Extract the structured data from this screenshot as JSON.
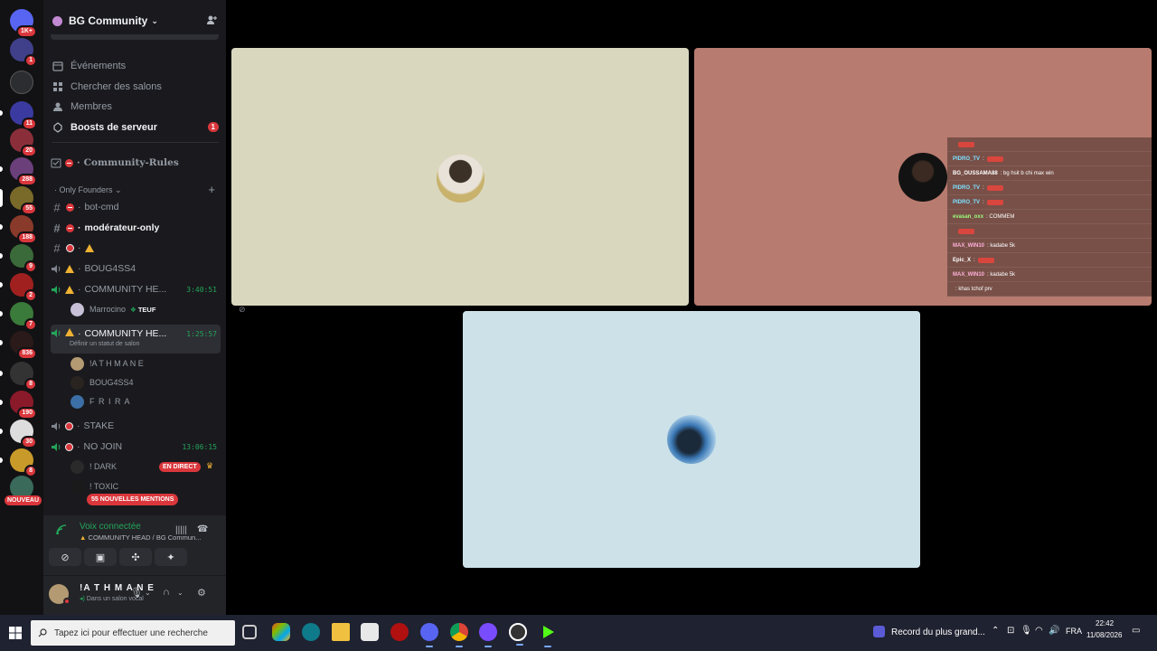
{
  "server_rail": {
    "badges": [
      "1K+",
      "1",
      "11",
      "20",
      "288",
      "55",
      "188",
      "9",
      "2",
      "7",
      "836",
      "8",
      "190",
      "30",
      "8"
    ],
    "new_label": "NOUVEAU"
  },
  "guild": {
    "name": "BG Community"
  },
  "shortcuts": [
    {
      "label": "Événements",
      "icon": "calendar-icon"
    },
    {
      "label": "Chercher des salons",
      "icon": "channel-browse-icon"
    },
    {
      "label": "Membres",
      "icon": "members-icon"
    },
    {
      "label": "Boosts de serveur",
      "icon": "boost-icon",
      "badge": "1"
    }
  ],
  "rules_channel": "Community-Rules",
  "category": "Only Founders",
  "channels": {
    "bot_cmd": "bot-cmd",
    "moderateur": "modérateur-only",
    "boug": "BOUG4SS4",
    "community1": "COMMUNITY HE...",
    "community1_timer": "3:40:51",
    "marrocino": "Marrocino",
    "teuf_tag": "TEUF",
    "community2": "COMMUNITY HE...",
    "community2_timer": "1:25:57",
    "community2_status": "Définir un statut de salon",
    "member1": "!A T H M A N E",
    "member2": "BOUG4SS4",
    "member3": "F R I R A",
    "stake": "STAKE",
    "nojoin": "NO JOIN",
    "nojoin_timer": "13:06:15",
    "dark": "! DARK",
    "live": "EN DIRECT",
    "toxic": "! TOXIC",
    "mentions": "55 NOUVELLES MENTIONS"
  },
  "voice": {
    "title": "Voix connectée",
    "subtitle": "COMMUNITY HEAD / BG Commun..."
  },
  "user": {
    "name": "!A T H M A N E",
    "status": "Dans un salon vocal"
  },
  "chat_overlay": [
    {
      "name": "",
      "text": "",
      "name_color": "#ff6b7d",
      "emote": true
    },
    {
      "name": "PIDRO_TV",
      "text": ":",
      "name_color": "#7ee0ff",
      "emote": true
    },
    {
      "name": "BG_OUSSAMA88",
      "text": ": bg hsit b chi max win",
      "name_color": "#ffffff",
      "emote": false
    },
    {
      "name": "PIDRO_TV",
      "text": ":",
      "name_color": "#7ee0ff",
      "emote": true
    },
    {
      "name": "PIDRO_TV",
      "text": ":",
      "name_color": "#7ee0ff",
      "emote": true
    },
    {
      "name": "evasan_oxx",
      "text": ": COMMEM",
      "name_color": "#9cff7a",
      "emote": false
    },
    {
      "name": "",
      "text": "",
      "name_color": "#ff6b7d",
      "emote": true
    },
    {
      "name": "MAX_WIN10",
      "text": ": kadabe 5k",
      "name_color": "#ffb0d9",
      "emote": false
    },
    {
      "name": "Epic_X",
      "text": ":",
      "name_color": "#ffffff",
      "emote": true
    },
    {
      "name": "MAX_WIN10",
      "text": ": kadabe 5k",
      "name_color": "#ffb0d9",
      "emote": false
    },
    {
      "name": "",
      "text": ": khas tchof prv",
      "name_color": "#ff6b7d",
      "emote": false
    }
  ],
  "taskbar": {
    "search_placeholder": "Tapez ici pour effectuer une recherche",
    "notification": "Record du plus grand...",
    "lang": "FRA",
    "time": "22:42",
    "date": "11/08/2026"
  },
  "colors": {
    "tile1": "#dad7bf",
    "tile2": "#b87b6f",
    "tile3": "#cde2e8",
    "accent_green": "#23a55a",
    "badge_red": "#da373c"
  }
}
